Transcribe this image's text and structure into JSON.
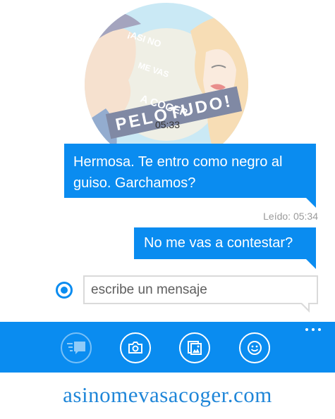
{
  "contact": {
    "avatar_texts": [
      "¡ASI NO",
      "ME VAS",
      "A COGER",
      "PELOTUDO!"
    ]
  },
  "conversation": {
    "timestamp": "05:33",
    "messages": [
      {
        "text": "Hermosa. Te entro como negro al guiso. Garchamos?",
        "direction": "outgoing"
      },
      {
        "text": "No me vas a contestar?",
        "direction": "outgoing"
      }
    ],
    "read_receipt": "Leído: 05:34"
  },
  "compose": {
    "placeholder": "escribe un mensaje"
  },
  "app_bar": {
    "buttons": [
      {
        "name": "send-icon",
        "enabled": false
      },
      {
        "name": "camera-icon",
        "enabled": true
      },
      {
        "name": "attach-icon",
        "enabled": true
      },
      {
        "name": "emoji-icon",
        "enabled": true
      }
    ],
    "more_icon": "more-dots-icon"
  },
  "watermark": "asinomevasacoger.com",
  "colors": {
    "accent": "#0a8cf0",
    "watermark": "#1f86d8",
    "read_receipt": "#9a9a9a"
  }
}
